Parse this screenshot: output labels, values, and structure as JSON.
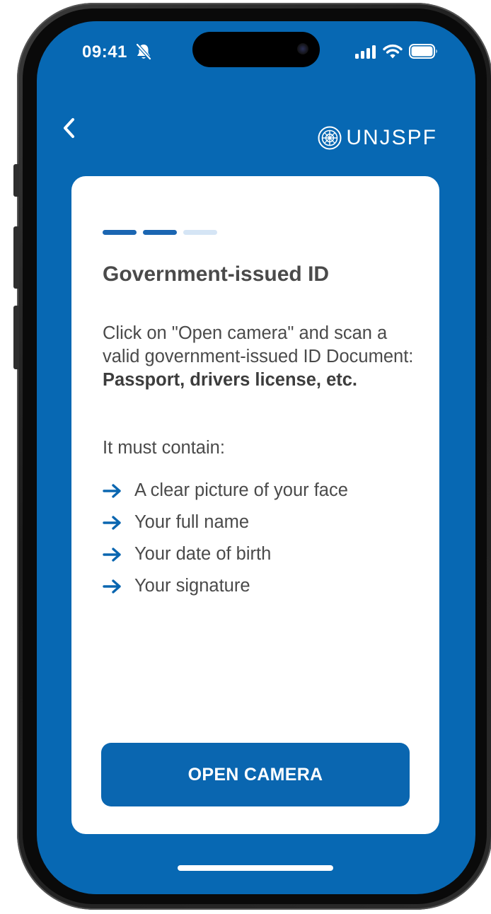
{
  "status_bar": {
    "time": "09:41",
    "icons": [
      "bell-slash-icon",
      "cellular-signal-icon",
      "wifi-icon",
      "battery-icon"
    ]
  },
  "header": {
    "back_icon": "chevron-left-icon",
    "logo_icon": "un-emblem-icon",
    "brand_name": "UNJSPF"
  },
  "card": {
    "progress": {
      "total_steps": 3,
      "completed_steps": 2,
      "active_color": "#1b66b2",
      "inactive_color": "#d5e5f5"
    },
    "title": "Government-issued ID",
    "intro_text": "Click on \"Open camera\" and scan a valid government-issued ID Document: ",
    "intro_bold": "Passport, drivers license, etc.",
    "must_contain_label": "It must contain:",
    "requirements": [
      "A clear picture of your face",
      "Your full name",
      "Your date of birth",
      "Your signature"
    ],
    "button_label": "OPEN CAMERA"
  },
  "colors": {
    "screen_background": "#0768b3",
    "card_background": "#ffffff",
    "button_background": "#0a66b0",
    "arrow": "#0a66b0",
    "text": "#4a4a4a"
  }
}
